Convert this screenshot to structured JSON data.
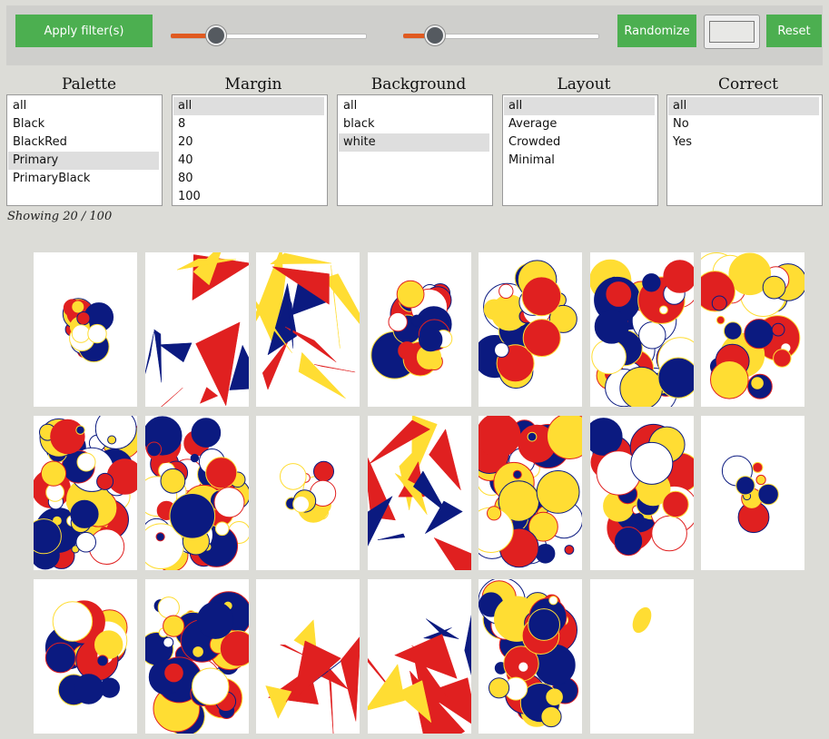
{
  "toolbar": {
    "apply_label": "Apply filter(s)",
    "randomize_label": "Randomize",
    "reset_label": "Reset",
    "slider1_value": 0.23,
    "slider2_value": 0.16
  },
  "filters": {
    "palette": {
      "title": "Palette",
      "options": [
        "all",
        "Black",
        "BlackRed",
        "Primary",
        "PrimaryBlack"
      ],
      "selected": "Primary"
    },
    "margin": {
      "title": "Margin",
      "options": [
        "all",
        "8",
        "20",
        "40",
        "80",
        "100"
      ],
      "selected": "all"
    },
    "background": {
      "title": "Background",
      "options": [
        "all",
        "black",
        "white"
      ],
      "selected": "white"
    },
    "layout": {
      "title": "Layout",
      "options": [
        "all",
        "Average",
        "Crowded",
        "Minimal"
      ],
      "selected": "all"
    },
    "correct": {
      "title": "Correct",
      "options": [
        "all",
        "No",
        "Yes"
      ],
      "selected": "all"
    }
  },
  "status": "Showing 20 / 100",
  "colors": {
    "navy": "#0b1a80",
    "red": "#e02020",
    "yellow": "#ffdd33",
    "accent": "#4caf50",
    "slider": "#e05a20"
  },
  "gallery_count": 20
}
